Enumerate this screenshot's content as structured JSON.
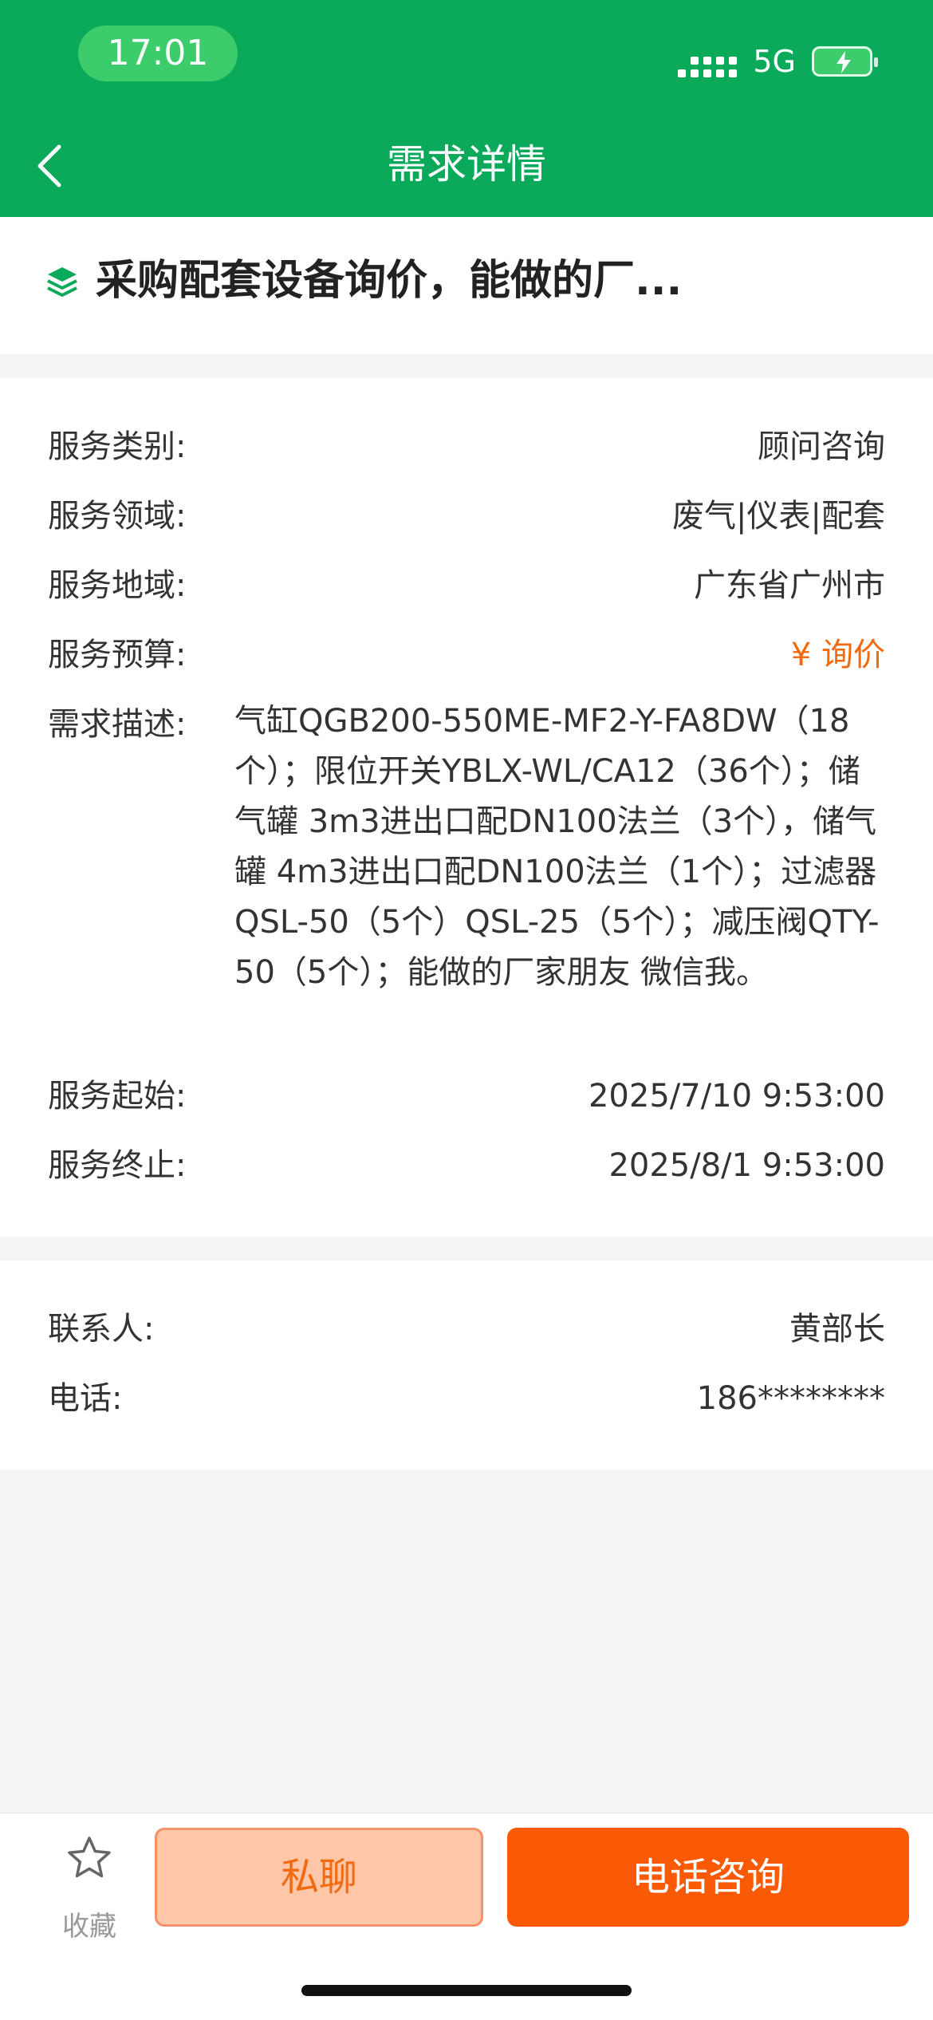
{
  "status_bar": {
    "time": "17:01",
    "network": "5G"
  },
  "header": {
    "title": "需求详情"
  },
  "demand": {
    "title": "采购配套设备询价，能做的厂...",
    "fields": [
      {
        "label": "服务类别:",
        "value": "顾问咨询"
      },
      {
        "label": "服务领域:",
        "value": "废气|仪表|配套"
      },
      {
        "label": "服务地域:",
        "value": "广东省广州市"
      },
      {
        "label": "服务预算:",
        "value": "¥ 询价"
      }
    ],
    "description_label": "需求描述:",
    "description": "气缸QGB200-550ME-MF2-Y-FA8DW（18个）；限位开关YBLX-WL/CA12（36个）；储气罐 3m3进出口配DN100法兰（3个），储气罐 4m3进出口配DN100法兰（1个）；过滤器QSL-50（5个）QSL-25（5个）；减压阀QTY-50（5个）；能做的厂家朋友 微信我。",
    "start": {
      "label": "服务起始:",
      "value": "2025/7/10 9:53:00"
    },
    "end": {
      "label": "服务终止:",
      "value": "2025/8/1 9:53:00"
    }
  },
  "contact": {
    "person": {
      "label": "联系人:",
      "value": "黄部长"
    },
    "phone": {
      "label": "电话:",
      "value": "186********"
    }
  },
  "bottom_bar": {
    "favorite_label": "收藏",
    "chat_label": "私聊",
    "call_label": "电话咨询"
  },
  "colors": {
    "header_green": "#0aaa5a",
    "budget_orange": "#f26a10",
    "call_button": "#fa5a05",
    "chat_button": "#ffc6a8"
  },
  "icons": {
    "back": "chevron-left-icon",
    "title": "layers-icon",
    "favorite": "star-outline-icon",
    "battery": "battery-charging-icon",
    "signal": "signal-icon"
  }
}
